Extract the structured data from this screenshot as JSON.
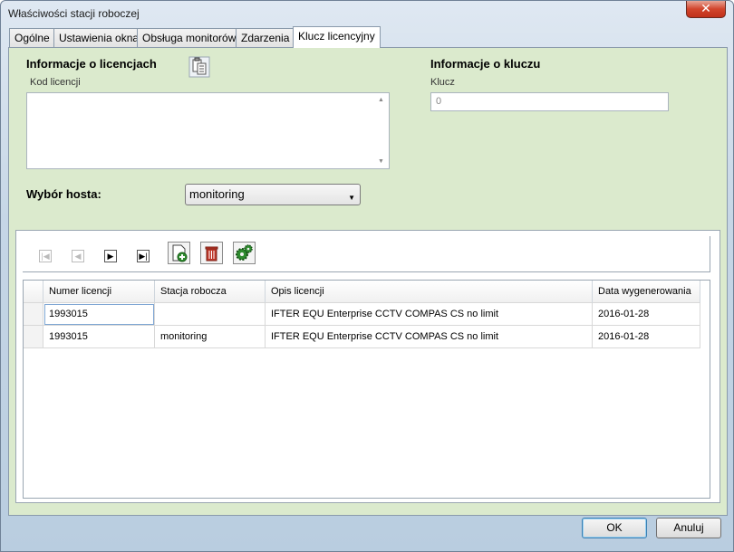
{
  "window": {
    "title": "Właściwości stacji roboczej",
    "close_label": "✕"
  },
  "tabs": [
    {
      "label": "Ogólne"
    },
    {
      "label": "Ustawienia okna"
    },
    {
      "label": "Obsługa monitorów"
    },
    {
      "label": "Zdarzenia"
    },
    {
      "label": "Klucz licencyjny"
    }
  ],
  "active_tab": "Klucz licencyjny",
  "license": {
    "section_title": "Informacje o licencjach",
    "code_label": "Kod licencji",
    "code_value": ""
  },
  "key": {
    "section_title": "Informacje o kluczu",
    "key_label": "Klucz",
    "key_value": "0"
  },
  "host": {
    "label": "Wybór hosta:",
    "selected": "monitoring"
  },
  "toolbar": {
    "first_icon": "first-record-icon",
    "prev_icon": "previous-record-icon",
    "next_icon": "next-record-icon",
    "last_icon": "last-record-icon",
    "add_icon": "add-document-icon",
    "delete_icon": "trash-icon",
    "settings_icon": "gears-icon"
  },
  "table": {
    "columns": [
      "Numer licencji",
      "Stacja robocza",
      "Opis licencji",
      "Data wygenerowania"
    ],
    "rows": [
      [
        "1993015",
        "",
        "IFTER EQU Enterprise CCTV COMPAS CS no limit",
        "2016-01-28"
      ],
      [
        "1993015",
        "monitoring",
        "IFTER EQU Enterprise CCTV COMPAS CS no limit",
        "2016-01-28"
      ]
    ]
  },
  "buttons": {
    "ok": "OK",
    "cancel": "Anuluj"
  },
  "colors": {
    "panel_bg": "#dbeacd",
    "close_red": "#c0301a",
    "icon_green": "#2e8b2e",
    "icon_red": "#c0392b"
  }
}
